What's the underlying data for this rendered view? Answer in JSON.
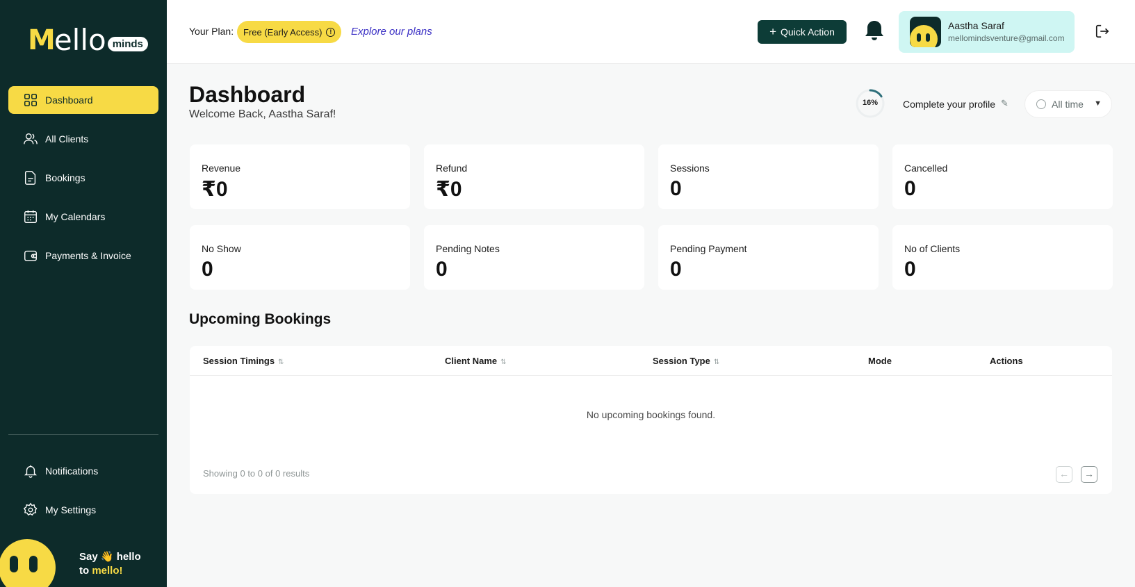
{
  "brand": {
    "logo_letter": "M",
    "logo_word": "ello",
    "logo_badge": "minds"
  },
  "sidebar": {
    "items": [
      {
        "label": "Dashboard",
        "icon": "grid-icon",
        "active": true
      },
      {
        "label": "All Clients",
        "icon": "users-icon"
      },
      {
        "label": "Bookings",
        "icon": "document-icon"
      },
      {
        "label": "My Calendars",
        "icon": "calendar-icon"
      },
      {
        "label": "Payments & Invoice",
        "icon": "wallet-icon"
      }
    ],
    "bottom_items": [
      {
        "label": "Notifications",
        "icon": "bell-icon"
      },
      {
        "label": "My Settings",
        "icon": "gear-icon"
      }
    ],
    "hello": {
      "line1": "Say 👋 hello",
      "line2_prefix": "to ",
      "line2_highlight": "mello!"
    }
  },
  "topbar": {
    "plan_label": "Your Plan:",
    "plan_value": "Free (Early Access)",
    "explore_link": "Explore our plans",
    "quick_action": "Quick Action",
    "user_name": "Aastha Saraf",
    "user_email": "mellomindsventure@gmail.com"
  },
  "header": {
    "title": "Dashboard",
    "subtitle": "Welcome Back, Aastha Saraf!",
    "profile_progress_percent": 16,
    "profile_progress_label": "16%",
    "complete_profile": "Complete your profile",
    "time_filter": "All time"
  },
  "stats": [
    {
      "label": "Revenue",
      "value": "₹0"
    },
    {
      "label": "Refund",
      "value": "₹0"
    },
    {
      "label": "Sessions",
      "value": "0"
    },
    {
      "label": "Cancelled",
      "value": "0"
    },
    {
      "label": "No Show",
      "value": "0"
    },
    {
      "label": "Pending Notes",
      "value": "0"
    },
    {
      "label": "Pending Payment",
      "value": "0"
    },
    {
      "label": "No of Clients",
      "value": "0"
    }
  ],
  "bookings": {
    "title": "Upcoming Bookings",
    "columns": [
      "Session Timings",
      "Client Name",
      "Session Type",
      "Mode",
      "Actions"
    ],
    "empty_text": "No upcoming bookings found.",
    "showing_text": "Showing 0 to 0 of 0 results"
  },
  "colors": {
    "sidebar": "#0d2b2a",
    "accent": "#f7da45",
    "button": "#0d3c37",
    "profile_card": "#cff6f3",
    "link": "#3a2fc4"
  }
}
